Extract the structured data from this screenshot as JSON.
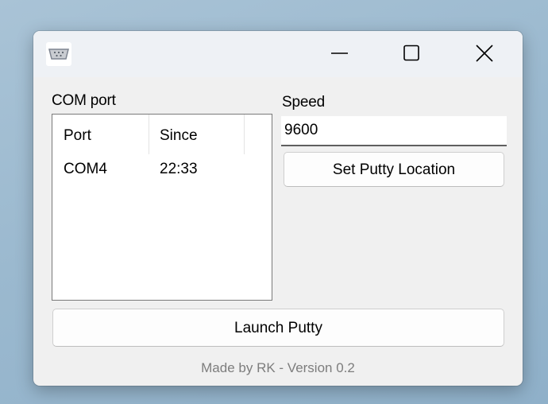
{
  "window": {
    "icon": "serial-port-icon",
    "controls": {
      "minimize": "minimize-icon",
      "maximize": "maximize-icon",
      "close": "close-icon"
    }
  },
  "com_port": {
    "label": "COM port",
    "columns": [
      "Port",
      "Since"
    ],
    "rows": [
      {
        "port": "COM4",
        "since": "22:33"
      }
    ]
  },
  "speed": {
    "label": "Speed",
    "value": "9600"
  },
  "buttons": {
    "set_putty_location": "Set Putty Location",
    "launch_putty": "Launch Putty"
  },
  "footer": "Made by RK - Version 0.2"
}
